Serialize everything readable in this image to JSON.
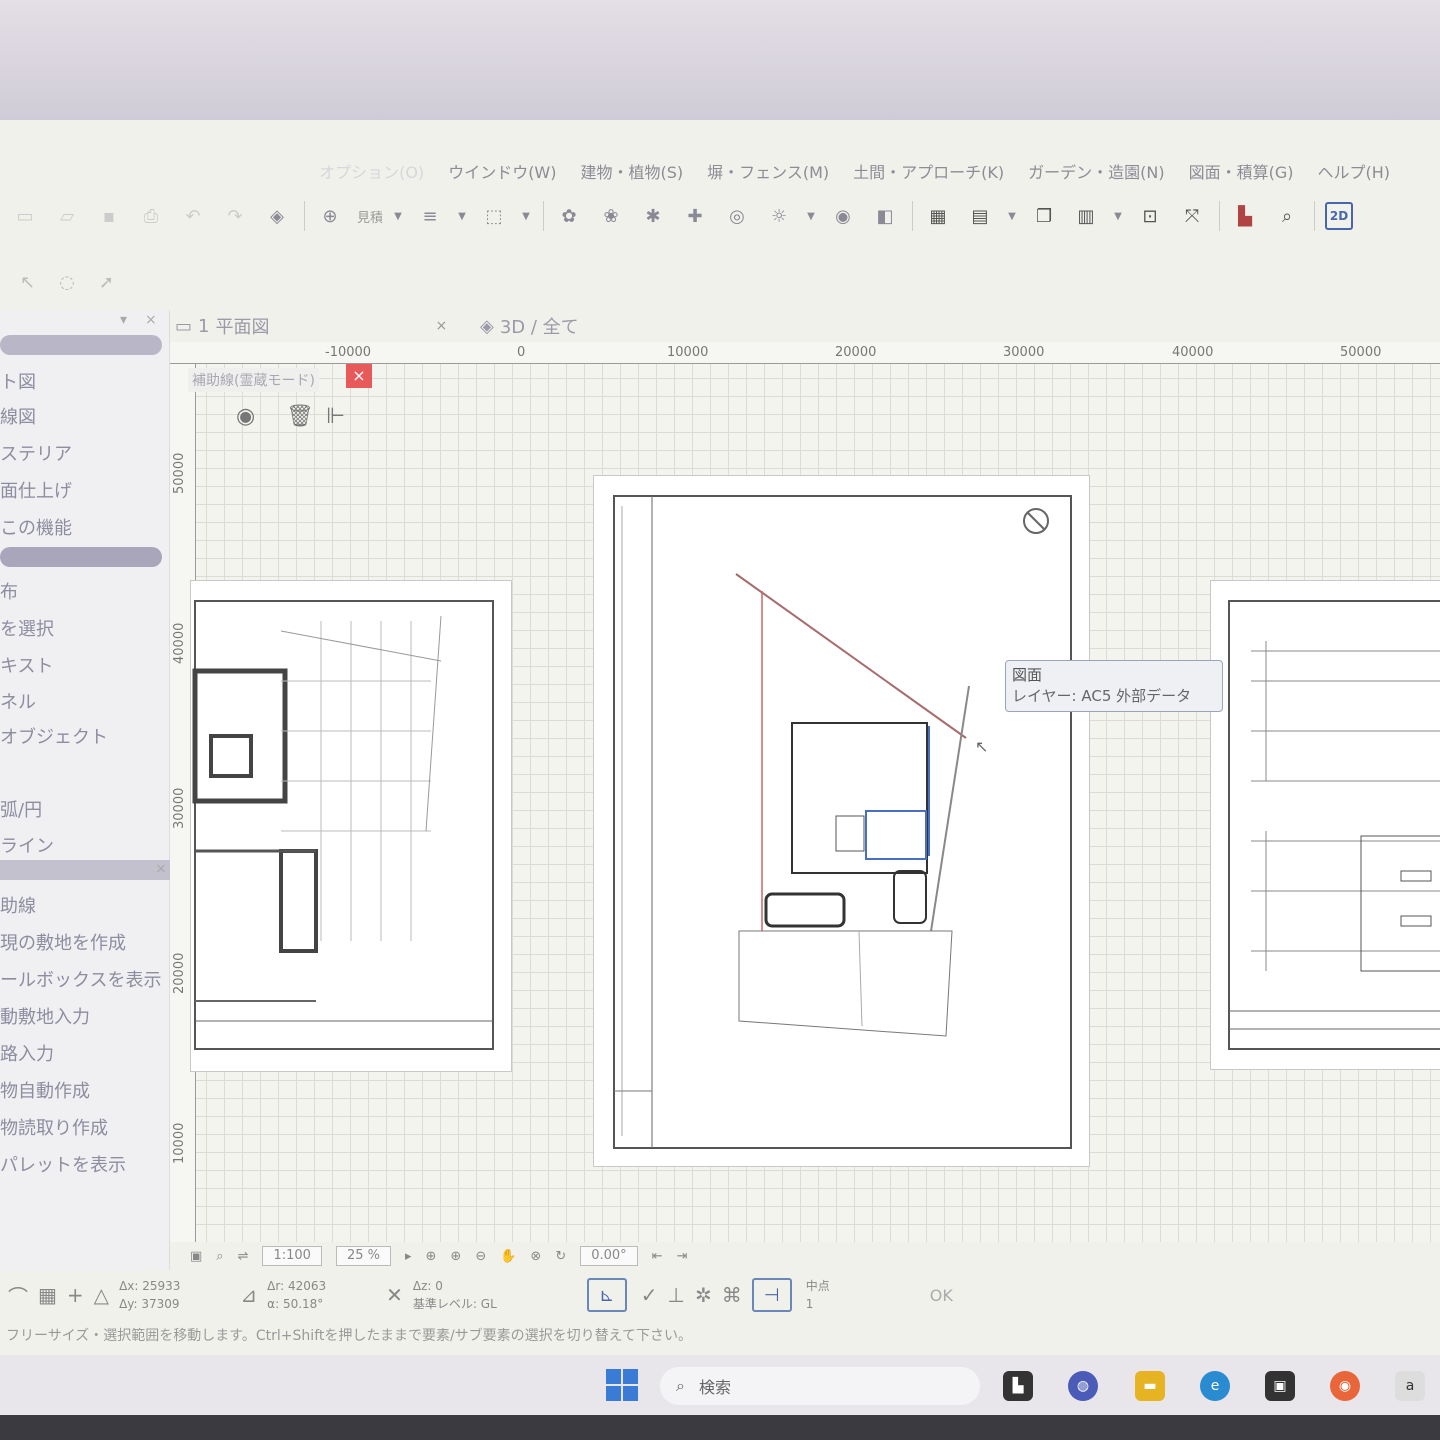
{
  "menu": [
    {
      "label": "オプション(O)",
      "faint": true
    },
    {
      "label": "ウインドウ(W)",
      "faint": false
    },
    {
      "label": "建物・植物(S)",
      "faint": false
    },
    {
      "label": "塀・フェンス(M)",
      "faint": false
    },
    {
      "label": "土間・アプローチ(K)",
      "faint": false
    },
    {
      "label": "ガーデン・造園(N)",
      "faint": false
    },
    {
      "label": "図面・積算(G)",
      "faint": false
    },
    {
      "label": "ヘルプ(H)",
      "faint": false
    }
  ],
  "toolbar": {
    "view_label": "見積",
    "mode_2d": "2D"
  },
  "tabs": {
    "plan": "平面図",
    "plan_number": "1",
    "view3d": "3D / 全て"
  },
  "left_panel": {
    "items_top": [
      "ト図",
      "線図",
      "ステリア",
      "面仕上げ",
      "この機能"
    ],
    "items_mid": [
      "布",
      "を選択",
      "キスト",
      "ネル",
      "オブジェクト"
    ],
    "items_draw": [
      "弧/円",
      "ライン"
    ],
    "items_bottom": [
      "助線",
      "現の敷地を作成",
      "ールボックスを表示",
      "動敷地入力",
      "路入力",
      "物自動作成",
      "物読取り作成",
      "パレットを表示"
    ]
  },
  "ruler": {
    "top": [
      "-10000",
      "0",
      "10000",
      "20000",
      "30000",
      "40000",
      "50000"
    ],
    "left": [
      "50000",
      "40000",
      "30000",
      "20000",
      "10000"
    ]
  },
  "float_palette": {
    "title": "補助線(霊蔵モード)",
    "close": "×"
  },
  "tooltip": {
    "title": "図面",
    "layer": "レイヤー: AC5 外部データ"
  },
  "viewbar": {
    "scale": "1:100",
    "zoom": "25 %",
    "angle": "0.00°"
  },
  "infobar": {
    "ax": "Δx: 25933",
    "ay": "Δy: 37309",
    "ar": "Δr: 42063",
    "aa": "α: 50.18°",
    "az": "Δz: 0",
    "level": "基準レベル: GL",
    "snap": "中点",
    "snap_val": "1",
    "ok": "OK"
  },
  "status": "フリーサイズ・選択範囲を移動します。Ctrl+Shiftを押したままで要素/サブ要素の選択を切り替えて下さい。",
  "taskbar": {
    "search": "検索"
  }
}
